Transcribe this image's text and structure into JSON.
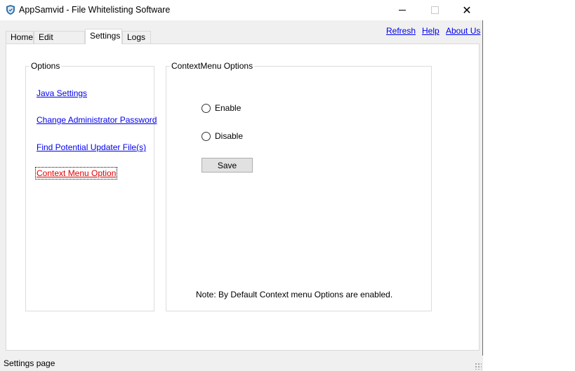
{
  "window": {
    "title": "AppSamvid - File Whitelisting Software",
    "icon": "shield-icon"
  },
  "tabs": [
    {
      "label": "Home",
      "active": false
    },
    {
      "label": "Edit Whitelist",
      "active": false
    },
    {
      "label": "Settings",
      "active": true
    },
    {
      "label": "Logs",
      "active": false
    }
  ],
  "header_links": {
    "refresh": "Refresh",
    "help": "Help",
    "about": "About Us"
  },
  "options_group": {
    "title": "Options",
    "items": [
      {
        "label": "Java Settings",
        "active": false
      },
      {
        "label": "Change Administrator Password",
        "active": false
      },
      {
        "label": "Find Potential Updater File(s)",
        "active": false
      },
      {
        "label": "Context Menu Option",
        "active": true
      }
    ]
  },
  "context_group": {
    "title": "ContextMenu Options",
    "radio_enable": "Enable",
    "radio_disable": "Disable",
    "selected": "",
    "save_label": "Save",
    "note": "Note: By Default Context menu Options are enabled."
  },
  "status": {
    "text": "Settings page"
  },
  "colors": {
    "link": "#0000ee",
    "active_link": "#e00000",
    "window_bg": "#f0f0f0",
    "panel_bg": "#ffffff"
  }
}
